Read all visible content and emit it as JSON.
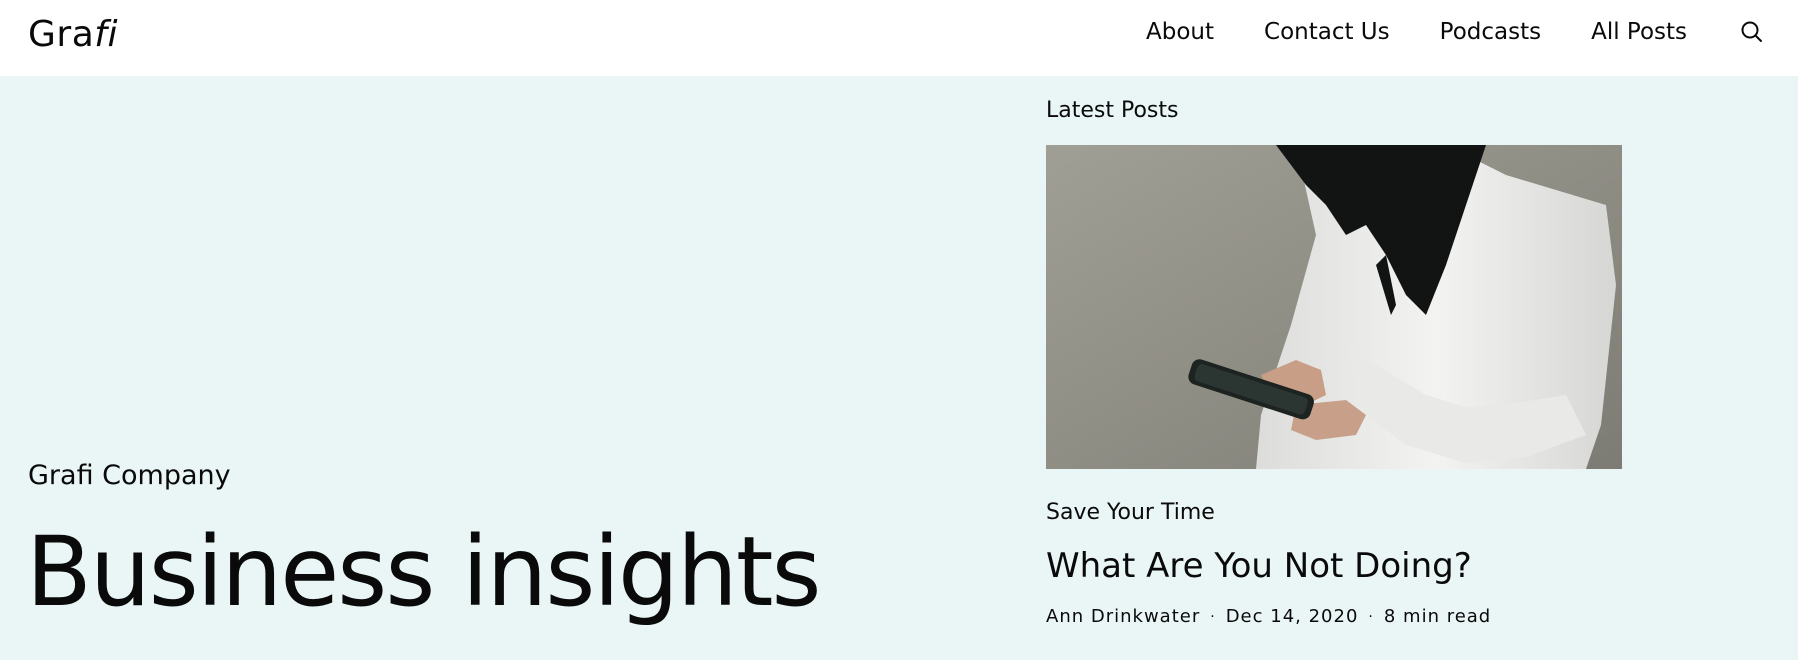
{
  "site": {
    "logo_regular": "Gra",
    "logo_italic": "fi"
  },
  "nav": {
    "items": [
      "About",
      "Contact Us",
      "Podcasts",
      "All Posts"
    ],
    "search_icon": "search-icon"
  },
  "hero": {
    "company": "Grafi Company",
    "title": "Business insights"
  },
  "latest": {
    "label": "Latest Posts",
    "post": {
      "image": "woman in white shirt holding smartphone",
      "category": "Save Your Time",
      "title": "What Are You Not Doing?",
      "author": "Ann Drinkwater",
      "date": "Dec 14, 2020",
      "read_time": "8 min read",
      "separator": "·"
    }
  },
  "colors": {
    "header_bg": "#ffffff",
    "page_bg": "#eaf6f6",
    "text": "#0a0a0a"
  }
}
